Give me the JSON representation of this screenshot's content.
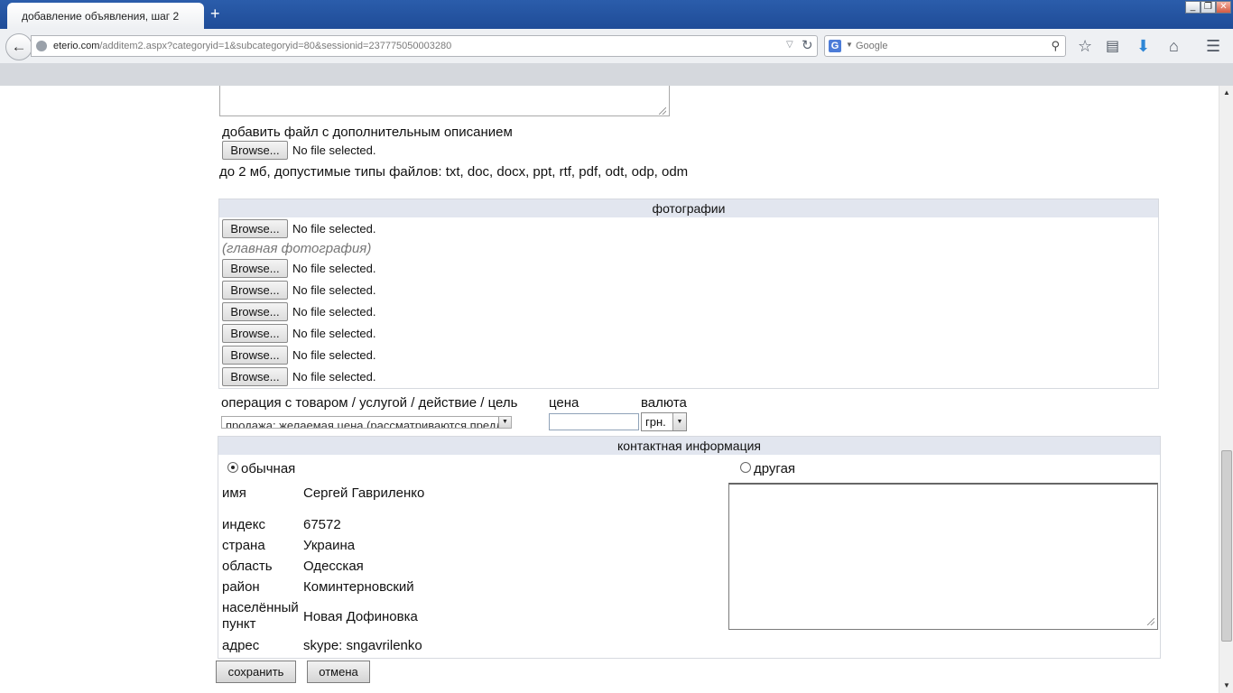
{
  "browser": {
    "tab_title": "добавление объявления, шаг 2",
    "new_tab": "+",
    "url_host": "eterio.com",
    "url_path": "/additem2.aspx?categoryid=1&subcategoryid=80&sessionid=237775050003280",
    "search_engine": "G",
    "search_placeholder": "Google",
    "window_controls": [
      "_",
      "❐",
      "✕"
    ]
  },
  "upload_section": {
    "label": "добавить файл с дополнительным описанием",
    "browse_label": "Browse...",
    "no_file_text": "No file selected.",
    "hint": "до 2 мб, допустимые типы файлов: txt, doc, docx, ppt, rtf, pdf, odt, odp, odm"
  },
  "photos": {
    "header": "фотографии",
    "main_photo_note": "(главная фотография)",
    "slots": [
      {
        "browse": "Browse...",
        "status": "No file selected."
      },
      {
        "browse": "Browse...",
        "status": "No file selected."
      },
      {
        "browse": "Browse...",
        "status": "No file selected."
      },
      {
        "browse": "Browse...",
        "status": "No file selected."
      },
      {
        "browse": "Browse...",
        "status": "No file selected."
      },
      {
        "browse": "Browse...",
        "status": "No file selected."
      },
      {
        "browse": "Browse...",
        "status": "No file selected."
      }
    ]
  },
  "offer": {
    "operation_label": "операция с товаром / услугой / действие / цель",
    "operation_value": "продажа: желаемая цена (рассматриваются предложения)",
    "price_label": "цена",
    "price_value": "",
    "currency_label": "валюта",
    "currency_value": "грн."
  },
  "contact": {
    "header": "контактная информация",
    "option_regular": "обычная",
    "option_other": "другая",
    "fields": [
      {
        "label": "имя",
        "value": "Сергей Гавриленко"
      },
      {
        "label": "индекс",
        "value": "67572"
      },
      {
        "label": "страна",
        "value": "Украина"
      },
      {
        "label": "область",
        "value": "Одесская"
      },
      {
        "label": "район",
        "value": "Коминтерновский"
      },
      {
        "label": "населённый пункт",
        "value": "Новая Дофиновка"
      },
      {
        "label": "адрес",
        "value": "skype: sngavrilenko"
      }
    ],
    "other_text": ""
  },
  "actions": {
    "save_label": "сохранить",
    "cancel_label": "отмена"
  }
}
